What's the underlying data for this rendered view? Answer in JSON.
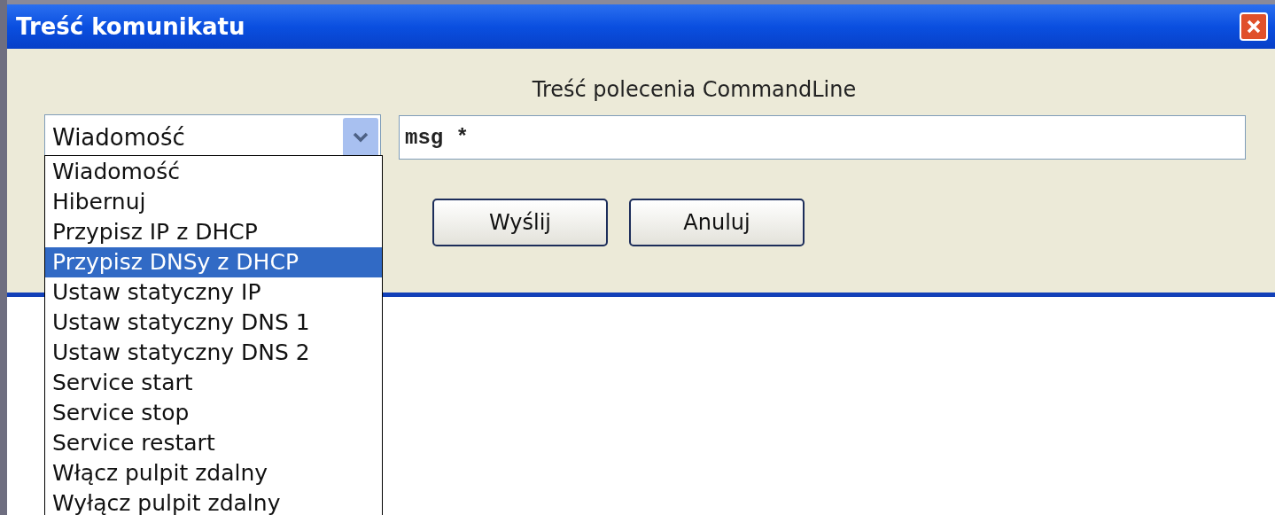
{
  "window": {
    "title": "Treść komunikatu"
  },
  "command_label": "Treść polecenia CommandLine",
  "action_combo": {
    "value": "Wiadomość",
    "expanded": true
  },
  "command_field": {
    "value": "msg *"
  },
  "buttons": [
    "Wyślij",
    "Anuluj"
  ],
  "dropdown_items": [
    {
      "label": "Wiadomość",
      "selected": false
    },
    {
      "label": "Hibernuj",
      "selected": false
    },
    {
      "label": "Przypisz IP z DHCP",
      "selected": false
    },
    {
      "label": "Przypisz DNSy z DHCP",
      "selected": true
    },
    {
      "label": "Ustaw statyczny IP",
      "selected": false
    },
    {
      "label": "Ustaw statyczny DNS 1",
      "selected": false
    },
    {
      "label": "Ustaw statyczny DNS 2",
      "selected": false
    },
    {
      "label": "Service start",
      "selected": false
    },
    {
      "label": "Service stop",
      "selected": false
    },
    {
      "label": "Service restart",
      "selected": false
    },
    {
      "label": "Włącz pulpit zdalny",
      "selected": false
    },
    {
      "label": "Wyłącz pulpit zdalny",
      "selected": false
    }
  ]
}
